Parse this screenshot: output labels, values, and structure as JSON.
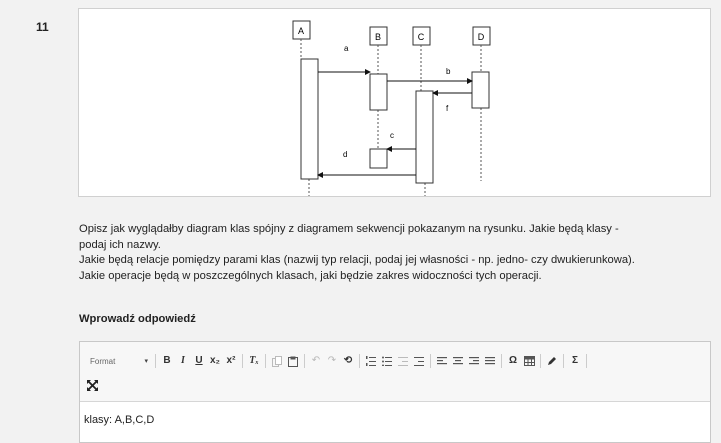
{
  "question": {
    "number": "11"
  },
  "diagram": {
    "lifelines": [
      "A",
      "B",
      "C",
      "D"
    ],
    "messages": [
      "a",
      "b",
      "c",
      "d",
      "f"
    ]
  },
  "prompt": {
    "lines": [
      "Opisz jak wyglądałby diagram klas spójny z diagramem sekwencji pokazanym na rysunku. Jakie będą klasy -",
      "podaj ich nazwy.",
      "Jakie będą relacje pomiędzy parami klas (nazwij typ relacji, podaj jej własności - np. jedno- czy dwukierunkowa).",
      "Jakie operacje będą w poszczególnych klasach, jaki będzie zakres widoczności tych operacji."
    ]
  },
  "answer": {
    "label": "Wprowadź odpowiedź",
    "format_label": "Format",
    "content": "klasy: A,B,C,D"
  },
  "toolbar": {
    "bold": "B",
    "italic": "I",
    "underline": "U",
    "subscript": "x₂",
    "superscript": "x²",
    "remove_format": "Tₓ",
    "omega": "Ω",
    "sigma": "Σ",
    "undo": "↶",
    "redo": "↷"
  }
}
